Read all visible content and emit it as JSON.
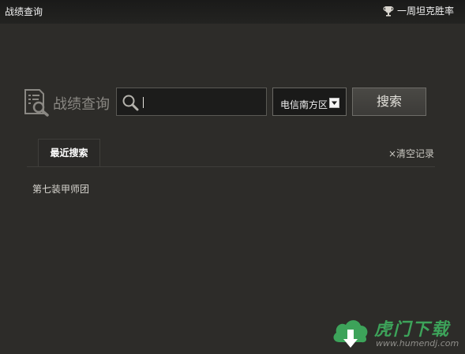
{
  "titlebar": {
    "title": "战绩查询",
    "winrate_label": "一周坦克胜率",
    "winrate_icon": "trophy-icon"
  },
  "search": {
    "heading": "战绩查询",
    "heading_icon": "record-search-icon",
    "input_value": "",
    "placeholder": "",
    "region_selected": "电信南方区",
    "button_label": "搜索"
  },
  "history": {
    "tab_label": "最近搜索",
    "clear_label": "×清空记录",
    "items": [
      "第七装甲师团"
    ]
  },
  "watermark": {
    "brand": "虎门下载",
    "url": "www.humendj.com"
  },
  "colors": {
    "background": "#2d2c29",
    "titlebar": "#1a1a19",
    "accent_green": "#3da35a"
  }
}
